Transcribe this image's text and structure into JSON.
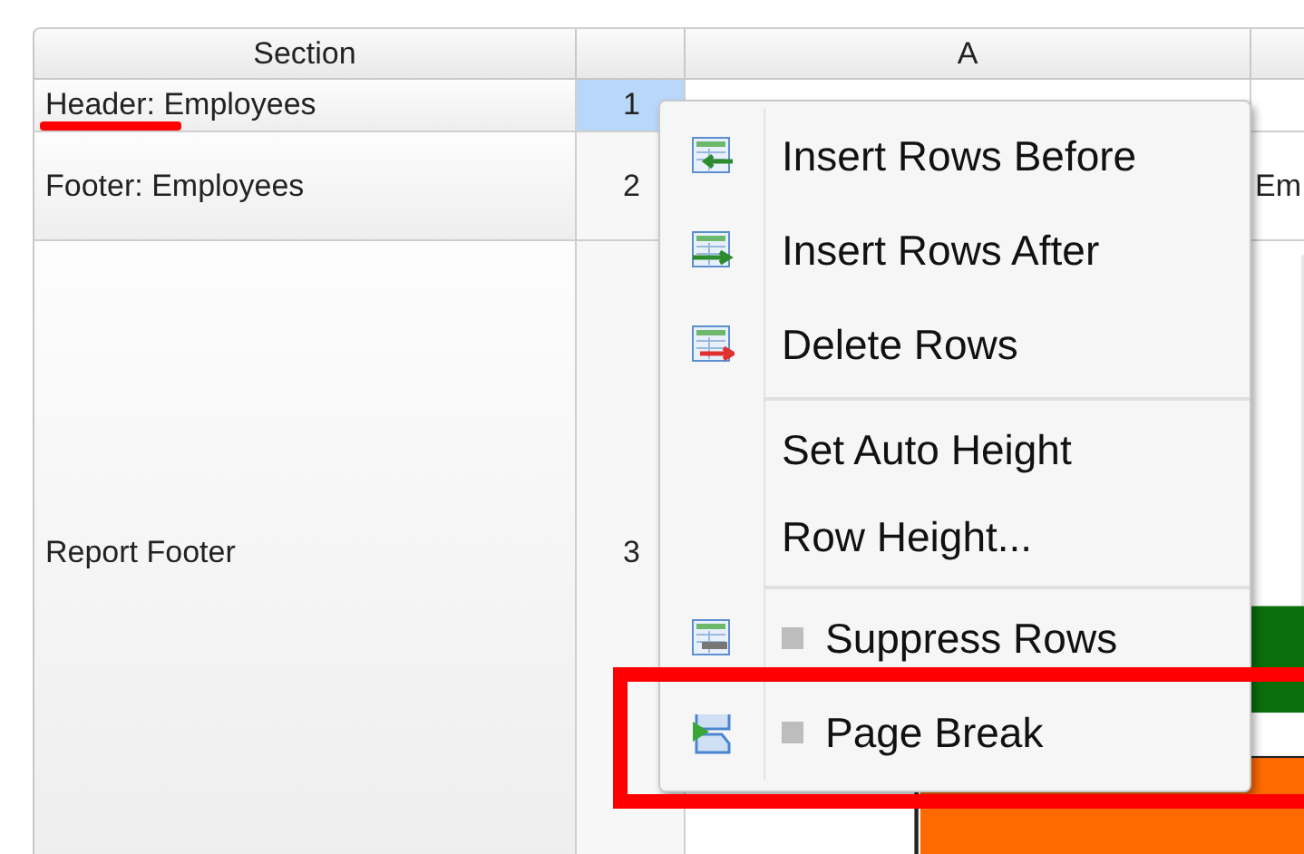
{
  "grid": {
    "columns": [
      "Section",
      "",
      "A",
      ""
    ],
    "rows": [
      {
        "section": "Header: Employees",
        "number": "1",
        "selected": true,
        "column_b": ""
      },
      {
        "section": "Footer: Employees",
        "number": "2",
        "selected": false,
        "column_b": "Em"
      },
      {
        "section": "Report Footer",
        "number": "3",
        "selected": false,
        "column_b": ""
      }
    ]
  },
  "context_menu": {
    "items": [
      {
        "kind": "command",
        "label": "Insert Rows Before"
      },
      {
        "kind": "command",
        "label": "Insert Rows After"
      },
      {
        "kind": "command",
        "label": "Delete Rows"
      },
      {
        "kind": "separator"
      },
      {
        "kind": "command",
        "label": "Set Auto Height"
      },
      {
        "kind": "command",
        "label": "Row Height..."
      },
      {
        "kind": "separator"
      },
      {
        "kind": "check",
        "label": "Suppress Rows",
        "checked": false
      },
      {
        "kind": "check",
        "label": "Page Break",
        "checked": false
      }
    ]
  }
}
